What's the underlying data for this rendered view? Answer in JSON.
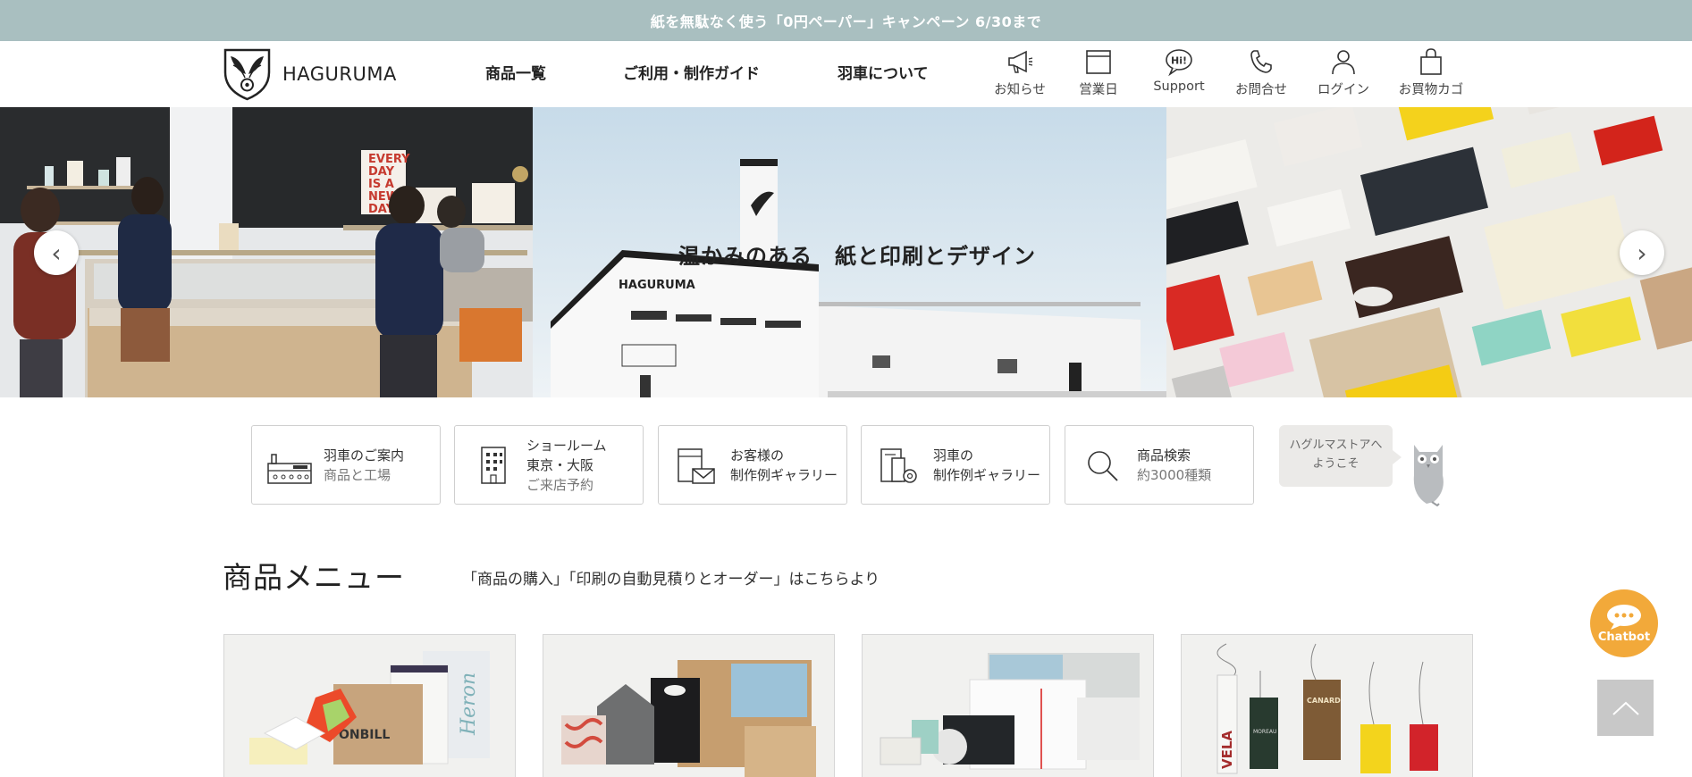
{
  "campaign": {
    "text": "紙を無駄なく使う「0円ペーパー」キャンペーン 6/30まで"
  },
  "header": {
    "logo_text": "HAGURUMA",
    "nav": [
      "商品一覧",
      "ご利用・制作ガイド",
      "羽車について"
    ],
    "utilities": [
      {
        "label": "お知らせ",
        "icon": "megaphone-icon"
      },
      {
        "label": "営業日",
        "icon": "calendar-icon"
      },
      {
        "label": "Support",
        "icon": "hi-bubble-icon"
      },
      {
        "label": "お問合せ",
        "icon": "phone-icon"
      },
      {
        "label": "ログイン",
        "icon": "user-icon"
      },
      {
        "label": "お買物カゴ",
        "icon": "shopping-bag-icon"
      }
    ]
  },
  "hero": {
    "caption": "温かみのある　紙と印刷とデザイン",
    "building_sign": "HAGURUMA",
    "poster_lines": [
      "EVERY",
      "DAY",
      "IS A",
      "NEW",
      "DAY"
    ],
    "prev_glyph": "‹",
    "next_glyph": "›"
  },
  "quick_links": [
    {
      "line1": "羽車のご案内",
      "line2": "商品と工場",
      "icon": "factory-icon"
    },
    {
      "line1": "ショールーム",
      "line2": "東京・大阪",
      "line3": "ご来店予約",
      "icon": "building-icon"
    },
    {
      "line1": "お客様の",
      "line2": "制作例ギャラリー",
      "icon": "customer-gallery-icon"
    },
    {
      "line1": "羽車の",
      "line2": "制作例ギャラリー",
      "icon": "haguruma-gallery-icon"
    },
    {
      "line1": "商品検索",
      "line2": "約3000種類",
      "icon": "search-icon"
    }
  ],
  "owl": {
    "line1": "ハグルマストアへ",
    "line2": "ようこそ"
  },
  "menu_section": {
    "title": "商品メニュー",
    "subtitle": "「商品の購入」「印刷の自動見積りとオーダー」はこちらより"
  },
  "product_cards": {
    "card1_labels": [
      "ONBILL",
      "Heron"
    ],
    "card4_labels": [
      "VELA",
      "CANARD",
      "MOREAU"
    ]
  },
  "chatbot": {
    "label": "Chatbot"
  },
  "colors": {
    "campaign_bar": "#a9bfc0",
    "chatbot": "#f2a93a",
    "scroll_top": "#c8c8c8"
  }
}
